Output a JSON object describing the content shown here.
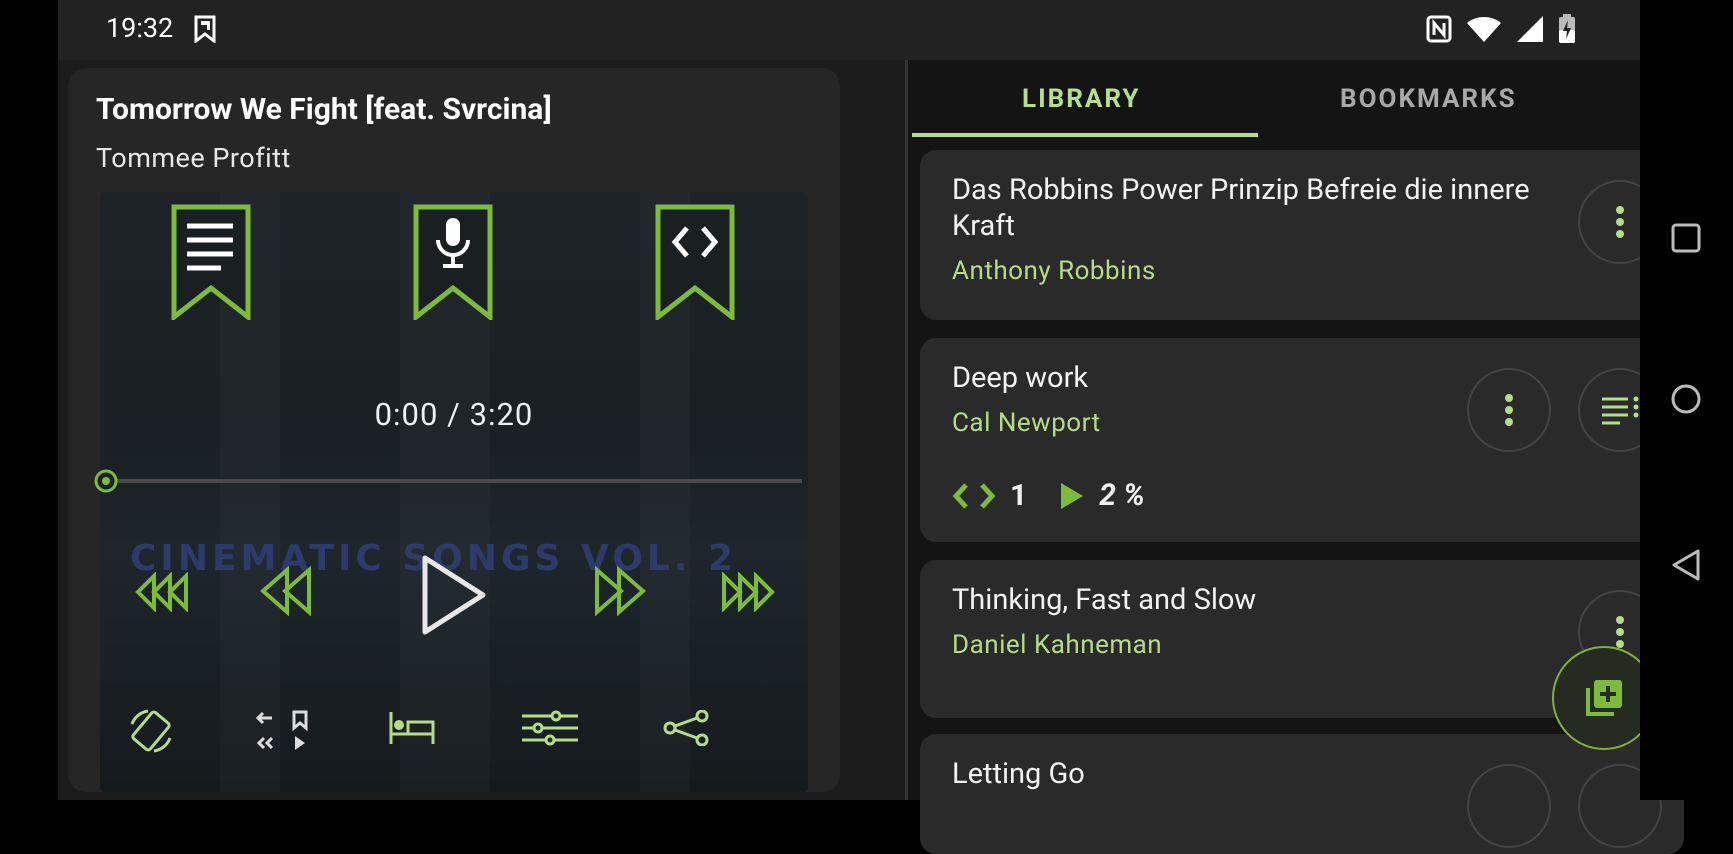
{
  "status_bar": {
    "time": "19:32"
  },
  "player": {
    "title": "Tomorrow We Fight [feat. Svrcina]",
    "artist": "Tommee Profitt",
    "album_art_text": "CINEMATIC SONGS VOL. 2",
    "time_display": "0:00 / 3:20",
    "progress_fraction": 0.0,
    "bookmark_icons": [
      "notes-bookmark-icon",
      "voice-bookmark-icon",
      "code-bookmark-icon"
    ],
    "controls": [
      "skip-back-long-icon",
      "rewind-icon",
      "play-icon",
      "fast-forward-icon",
      "skip-forward-long-icon"
    ],
    "tools": [
      "rotate-icon",
      "jump-bookmark-icon",
      "sleep-timer-icon",
      "equalizer-icon",
      "share-icon"
    ]
  },
  "library": {
    "tabs": [
      {
        "label": "LIBRARY",
        "active": true
      },
      {
        "label": "BOOKMARKS",
        "active": false
      }
    ],
    "books": [
      {
        "title": "Das Robbins Power Prinzip Befreie die innere Kraft",
        "author": "Anthony Robbins"
      },
      {
        "title": "Deep work",
        "author": "Cal Newport",
        "bookmarks": "1",
        "progress": "2 %"
      },
      {
        "title": "Thinking, Fast and Slow",
        "author": "Daniel Kahneman"
      },
      {
        "title": "Letting Go",
        "author": ""
      }
    ]
  },
  "colors": {
    "accent": "#7dbb3a",
    "accent_light": "#b3de86",
    "background": "#1c1c1c",
    "card": "#2a2a2a"
  }
}
